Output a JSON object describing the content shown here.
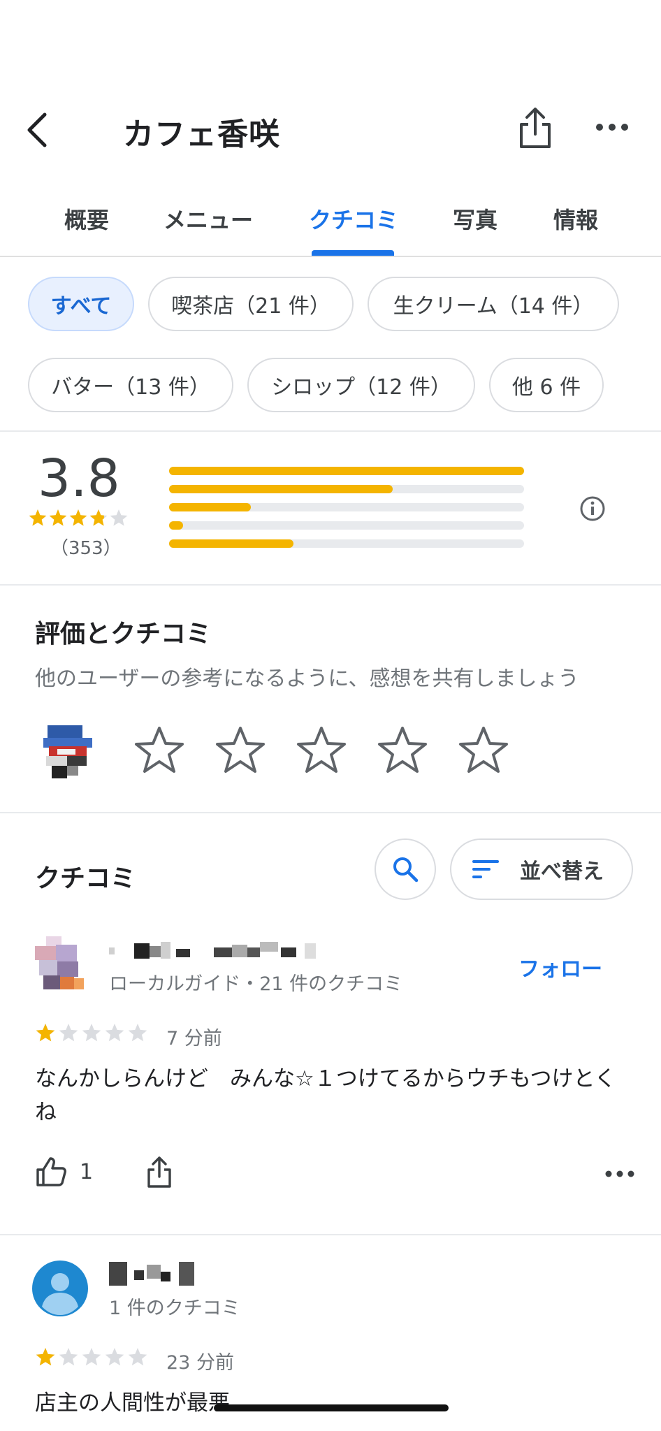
{
  "header": {
    "title": "カフェ香咲",
    "back_icon": "chevron-left-icon",
    "share_icon": "share-icon",
    "more_icon": "more-horizontal-icon"
  },
  "tabs": [
    {
      "label": "概要",
      "active": false
    },
    {
      "label": "メニュー",
      "active": false
    },
    {
      "label": "クチコミ",
      "active": true
    },
    {
      "label": "写真",
      "active": false
    },
    {
      "label": "情報",
      "active": false
    }
  ],
  "filter_chips": [
    {
      "label": "すべて",
      "selected": true
    },
    {
      "label": "喫茶店（21 件）",
      "selected": false
    },
    {
      "label": "生クリーム（14 件）",
      "selected": false
    },
    {
      "label": "バター（13 件）",
      "selected": false
    },
    {
      "label": "シロップ（12 件）",
      "selected": false
    },
    {
      "label": "他 6 件",
      "selected": false
    }
  ],
  "summary": {
    "rating": "3.8",
    "stars": 3.8,
    "count": "（353）",
    "distribution": [
      {
        "stars": 5,
        "fraction": 1.0
      },
      {
        "stars": 4,
        "fraction": 0.63
      },
      {
        "stars": 3,
        "fraction": 0.23
      },
      {
        "stars": 2,
        "fraction": 0.04
      },
      {
        "stars": 1,
        "fraction": 0.35
      }
    ]
  },
  "rate_section": {
    "title": "評価とクチコミ",
    "subtitle": "他のユーザーの参考になるように、感想を共有しましょう"
  },
  "reviews_header": {
    "title": "クチコミ",
    "sort_label": "並べ替え"
  },
  "reviews": [
    {
      "meta": "ローカルガイド・21 件のクチコミ",
      "follow_label": "フォロー",
      "stars": 1,
      "time": "7 分前",
      "text": "なんかしらんけど　みんな☆１つけてるからウチもつけとくね",
      "likes": "1"
    },
    {
      "meta": "1 件のクチコミ",
      "stars": 1,
      "time": "23 分前",
      "text": "店主の人間性が最悪"
    }
  ],
  "colors": {
    "accent": "#1a73e8",
    "star": "#f4b400",
    "chip_selected_bg": "#e8f0fe"
  }
}
